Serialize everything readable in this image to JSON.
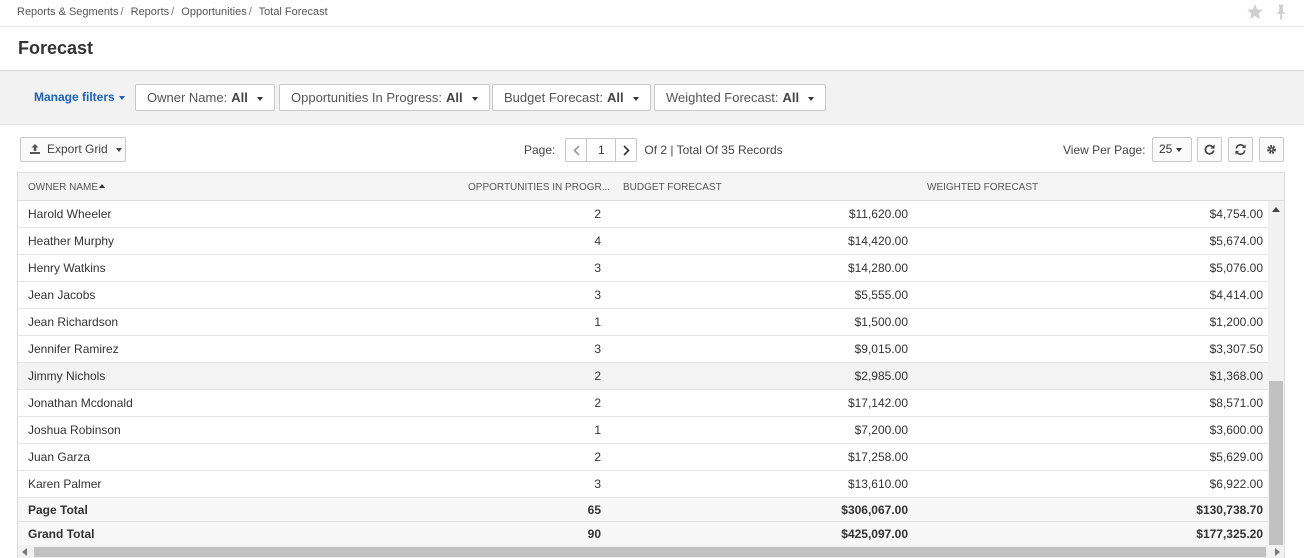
{
  "breadcrumb": [
    "Reports & Segments",
    "Reports",
    "Opportunities",
    "Total Forecast"
  ],
  "page_title": "Forecast",
  "filters": {
    "manage_label": "Manage filters",
    "items": [
      {
        "label": "Owner Name:",
        "value": "All"
      },
      {
        "label": "Opportunities In Progress:",
        "value": "All"
      },
      {
        "label": "Budget Forecast:",
        "value": "All"
      },
      {
        "label": "Weighted Forecast:",
        "value": "All"
      }
    ]
  },
  "toolbar": {
    "export_label": "Export Grid",
    "page_label": "Page:",
    "page_value": "1",
    "page_info": "Of 2 | Total Of 35 Records",
    "view_per_page_label": "View Per Page:",
    "view_per_page_value": "25"
  },
  "grid": {
    "columns": [
      "Owner Name",
      "Opportunities In Progr...",
      "Budget Forecast",
      "Weighted Forecast"
    ],
    "rows": [
      [
        "Harold Wheeler",
        "2",
        "$11,620.00",
        "$4,754.00"
      ],
      [
        "Heather Murphy",
        "4",
        "$14,420.00",
        "$5,674.00"
      ],
      [
        "Henry Watkins",
        "3",
        "$14,280.00",
        "$5,076.00"
      ],
      [
        "Jean Jacobs",
        "3",
        "$5,555.00",
        "$4,414.00"
      ],
      [
        "Jean Richardson",
        "1",
        "$1,500.00",
        "$1,200.00"
      ],
      [
        "Jennifer Ramirez",
        "3",
        "$9,015.00",
        "$3,307.50"
      ],
      [
        "Jimmy Nichols",
        "2",
        "$2,985.00",
        "$1,368.00"
      ],
      [
        "Jonathan Mcdonald",
        "2",
        "$17,142.00",
        "$8,571.00"
      ],
      [
        "Joshua Robinson",
        "1",
        "$7,200.00",
        "$3,600.00"
      ],
      [
        "Juan Garza",
        "2",
        "$17,258.00",
        "$5,629.00"
      ],
      [
        "Karen Palmer",
        "3",
        "$13,610.00",
        "$6,922.00"
      ]
    ],
    "totals": [
      [
        "Page Total",
        "65",
        "$306,067.00",
        "$130,738.70"
      ],
      [
        "Grand Total",
        "90",
        "$425,097.00",
        "$177,325.20"
      ]
    ]
  },
  "icons": {
    "favorite": "star-icon",
    "pin": "pin-icon",
    "export": "upload-icon",
    "refresh": "refresh-icon",
    "sync": "sync-icon",
    "settings": "gear-icon"
  },
  "colors": {
    "link": "#1a63b8",
    "filter_bar": "#f2f2f2",
    "header_bg": "#f5f5f5"
  }
}
